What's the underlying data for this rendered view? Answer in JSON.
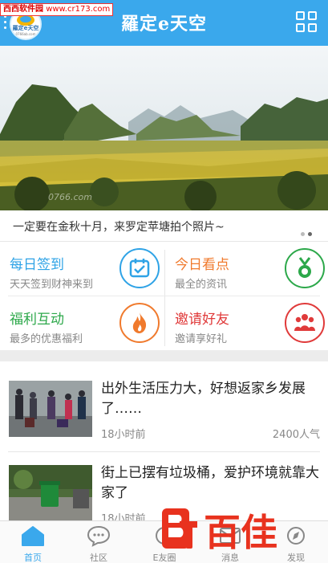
{
  "watermark": {
    "site_label": "西西软件园",
    "site_url": "www.cr173.com",
    "brand_mark": "百佳"
  },
  "header": {
    "title": "羅定e天空",
    "logo_text": "羅定e天空",
    "logo_sub": "0766ab.com",
    "accent": "#3aa8ec"
  },
  "banner": {
    "caption": "一定要在金秋十月，来罗定苹塘拍个照片~",
    "pages": 2,
    "active_page": 1,
    "photo_watermark": "0766.com"
  },
  "features": [
    {
      "title": "每日签到",
      "subtitle": "天天签到财神来到",
      "color": "#2fa3e6",
      "icon": "calendar-check-icon"
    },
    {
      "title": "今日看点",
      "subtitle": "最全的资讯",
      "color": "#f07a2d",
      "icon": "medal-icon"
    },
    {
      "title": "福利互动",
      "subtitle": "最多的优惠福利",
      "color": "#2ca84a",
      "icon": "flame-icon"
    },
    {
      "title": "邀请好友",
      "subtitle": "邀请享好礼",
      "color": "#e03a3a",
      "icon": "people-group-icon"
    }
  ],
  "news": [
    {
      "title": "出外生活压力大，好想返家乡发展了……",
      "time": "18小时前",
      "views": "2400人气"
    },
    {
      "title": "街上已摆有垃圾桶，爱护环境就靠大家了",
      "time": "18小时前",
      "views": ""
    }
  ],
  "nav": [
    {
      "label": "首页",
      "icon": "home-icon",
      "active": true
    },
    {
      "label": "社区",
      "icon": "chat-bubble-icon",
      "active": false
    },
    {
      "label": "E友圈",
      "icon": "circle-icon",
      "active": false
    },
    {
      "label": "消息",
      "icon": "message-icon",
      "active": false
    },
    {
      "label": "发现",
      "icon": "discover-icon",
      "active": false
    }
  ]
}
